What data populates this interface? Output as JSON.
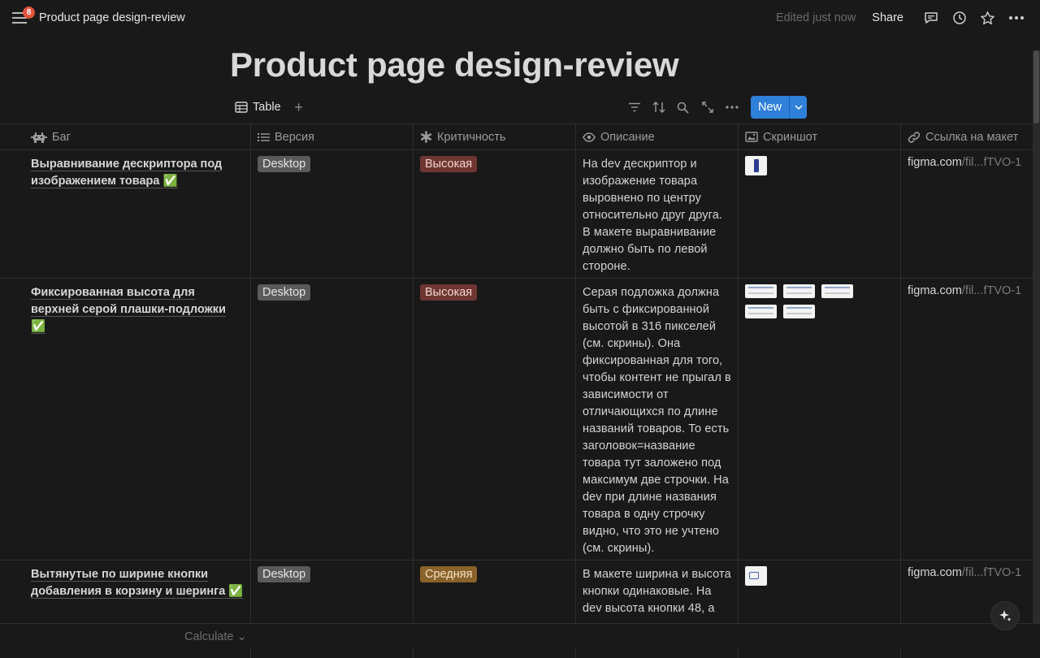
{
  "topbar": {
    "notification_count": "8",
    "title": "Product page design-review",
    "edited": "Edited just now",
    "share": "Share"
  },
  "page": {
    "title": "Product page design-review"
  },
  "view": {
    "tab_label": "Table",
    "new_label": "New"
  },
  "columns": [
    {
      "label": "Баг",
      "icon": "bug-icon"
    },
    {
      "label": "Версия",
      "icon": "list-icon"
    },
    {
      "label": "Критичность",
      "icon": "asterisk-icon"
    },
    {
      "label": "Описание",
      "icon": "eye-icon"
    },
    {
      "label": "Скриншот",
      "icon": "image-icon"
    },
    {
      "label": "Ссылка на макет",
      "icon": "link-icon"
    }
  ],
  "rows": [
    {
      "bug": "Выравнивание дескриптора под изображением товара ✅",
      "version": "Desktop",
      "severity": "Высокая",
      "description": "На dev дескриптор и изображение товара выровнено по центру относительно друг друга. В макете выравнивание должно быть по левой стороне.",
      "link_main": "figma.com",
      "link_tail": "/fil...fTVO-1"
    },
    {
      "bug": "Фиксированная высота для верхней серой плашки-подложки ✅",
      "version": "Desktop",
      "severity": "Высокая",
      "description": "Серая подложка должна быть с фиксированной высотой в 316 пикселей (см. скрины). Она фиксированная для того, чтобы контент не прыгал в зависимости от отличающихся по длине названий товаров. То есть заголовок=название товара тут заложено под максимум две строчки. На dev при длине названия товара в одну строчку видно, что это не учтено (см. скрины).",
      "link_main": "figma.com",
      "link_tail": "/fil...fTVO-1"
    },
    {
      "bug": "Вытянутые по ширине кнопки добавления в корзину и шеринга ✅",
      "version": "Desktop",
      "severity": "Средняя",
      "description": "В макете ширина и высота кнопки одинаковые. На dev высота кнопки 48, а",
      "link_main": "figma.com",
      "link_tail": "/fil...fTVO-1"
    }
  ],
  "footer": {
    "calculate": "Calculate ⌄"
  },
  "colors": {
    "background": "#191919",
    "accent_blue": "#2f80d9",
    "tag_grey": "#5a5a5a",
    "tag_red": "#6e3630",
    "tag_orange": "#89632a",
    "badge_red": "#e0533c"
  }
}
